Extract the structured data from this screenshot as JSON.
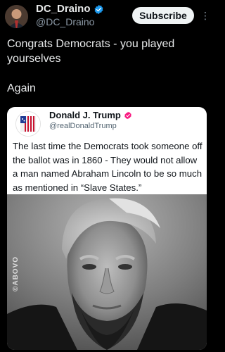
{
  "post": {
    "display_name": "DC_Draino",
    "handle": "@DC_Draino",
    "subscribe_label": "Subscribe",
    "text": "Congrats Democrats - you played yourselves\n\nAgain"
  },
  "embedded_post": {
    "display_name": "Donald J. Trump",
    "handle": "@realDonaldTrump",
    "text": "The last time the Democrats took someone off the ballot was in 1860 - They would not allow a man named Abraham Lincoln to be so much as mentioned in “Slave States.”",
    "watermark": "©ABOVO"
  },
  "colors": {
    "background": "#000000",
    "verified_badge": "#1d9bf0",
    "embed_verified_badge": "#f91880",
    "subscribe_bg": "#eff3f4"
  },
  "icons": {
    "verified": "verified-badge-icon",
    "more": "more-icon"
  }
}
